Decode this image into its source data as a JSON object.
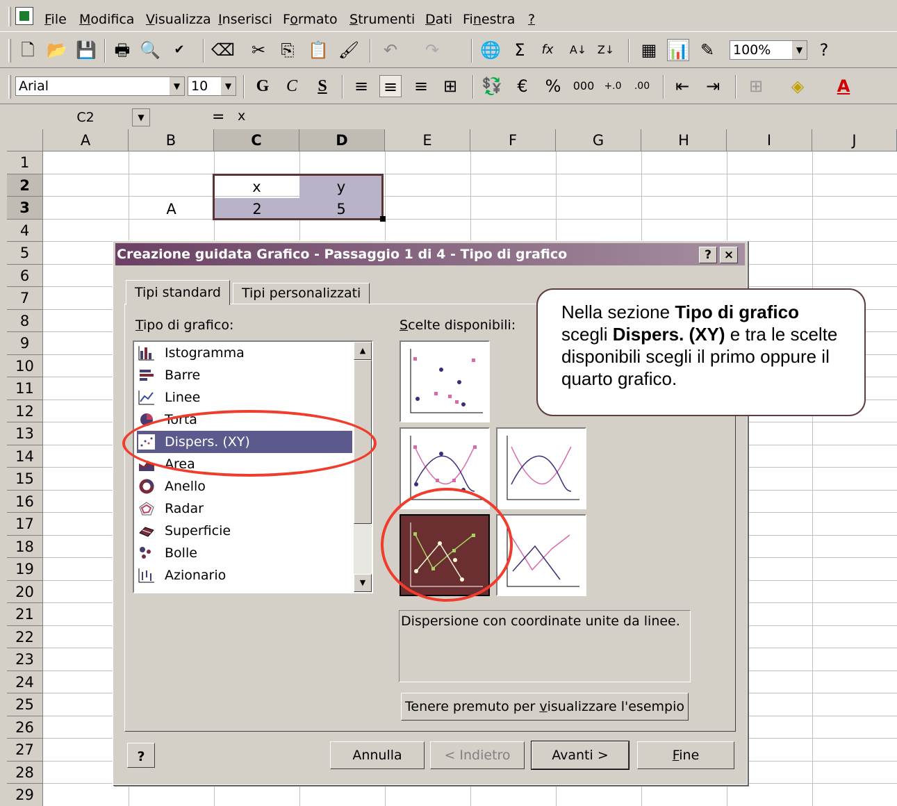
{
  "menubar": {
    "items": [
      {
        "pre": "",
        "u": "F",
        "post": "ile"
      },
      {
        "pre": "",
        "u": "M",
        "post": "odifica"
      },
      {
        "pre": "",
        "u": "V",
        "post": "isualizza"
      },
      {
        "pre": "",
        "u": "I",
        "post": "nserisci"
      },
      {
        "pre": "F",
        "u": "o",
        "post": "rmato"
      },
      {
        "pre": "",
        "u": "S",
        "post": "trumenti"
      },
      {
        "pre": "",
        "u": "D",
        "post": "ati"
      },
      {
        "pre": "Fi",
        "u": "n",
        "post": "estra"
      },
      {
        "pre": "",
        "u": "?",
        "post": ""
      }
    ]
  },
  "toolbar1": {
    "zoom": "100%"
  },
  "toolbar2": {
    "font": "Arial",
    "size": "10",
    "bold": "G",
    "italic": "C",
    "underline": "S"
  },
  "formula": {
    "namebox": "C2",
    "eq": "=",
    "value": "x"
  },
  "sheet": {
    "columns": [
      "A",
      "B",
      "C",
      "D",
      "E",
      "F",
      "G",
      "H",
      "I",
      "J"
    ],
    "rows": [
      "1",
      "2",
      "3",
      "4",
      "5",
      "6",
      "7",
      "8",
      "9",
      "10",
      "11",
      "12",
      "13",
      "14",
      "15",
      "16",
      "17",
      "18",
      "19",
      "20",
      "21",
      "22",
      "23",
      "24",
      "25",
      "26",
      "27",
      "28",
      "29"
    ],
    "cells": {
      "c2": "x",
      "d2": "y",
      "b3": "A",
      "c3": "2",
      "d3": "5"
    }
  },
  "dialog": {
    "title": "Creazione guidata Grafico - Passaggio 1 di 4 - Tipo di grafico",
    "help_btn": "?",
    "close_btn": "×",
    "tabs": [
      "Tipi standard",
      "Tipi personalizzati"
    ],
    "type_label": {
      "u": "T",
      "post": "ipo di grafico:"
    },
    "subtype_label": {
      "u": "S",
      "post": "celte disponibili:"
    },
    "chart_types": [
      "Istogramma",
      "Barre",
      "Linee",
      "Torta",
      "Dispers. (XY)",
      "Area",
      "Anello",
      "Radar",
      "Superficie",
      "Bolle",
      "Azionario"
    ],
    "selected_type": "Dispers. (XY)",
    "description": "Dispersione con coordinate unite da linee.",
    "preview_btn": {
      "pre": "Tenere premuto per ",
      "u": "v",
      "post": "isualizzare l'esempio"
    },
    "buttons": {
      "cancel": "Annulla",
      "back": "< Indietro",
      "next": "Avanti >",
      "finish_u": "F",
      "finish_post": "ine"
    },
    "help_icon": "?"
  },
  "callout": {
    "t1": "Nella sezione ",
    "b1": "Tipo di grafico",
    "t2": " scegli ",
    "b2": "Dispers. (XY)",
    "t3": " e tra le scelte disponibili scegli il primo oppure il quarto grafico."
  },
  "colors": {
    "title_start": "#6b4064",
    "selected_item": "#5c5a8c",
    "annotation_ring": "#f03c2c"
  }
}
